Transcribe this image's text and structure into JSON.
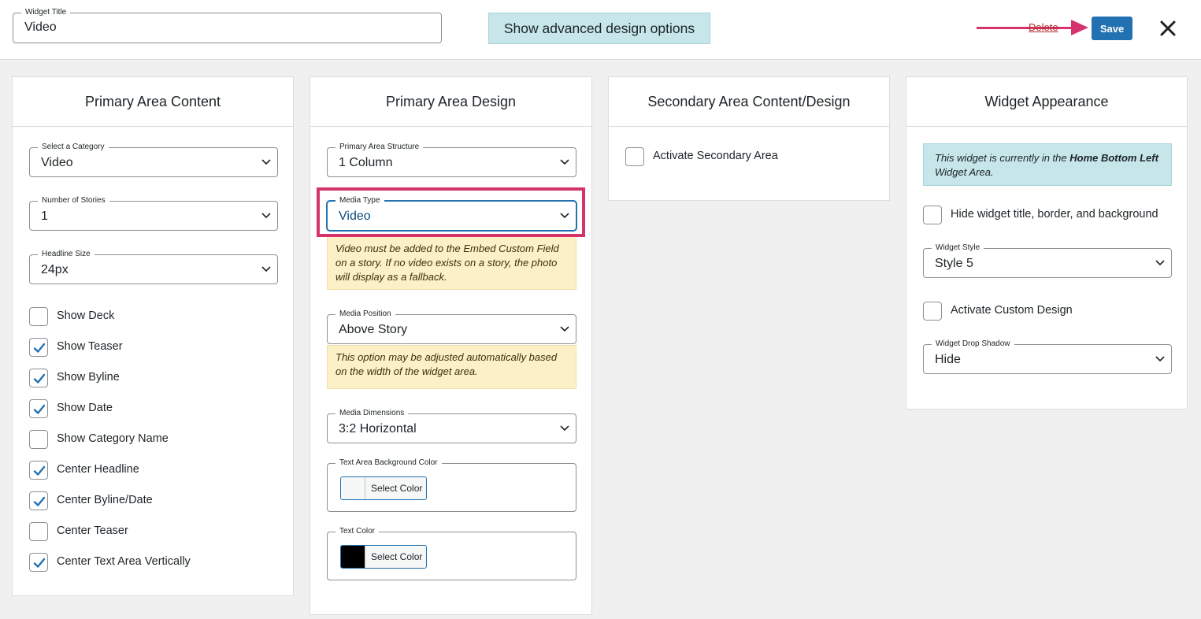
{
  "header": {
    "title_legend": "Widget Title",
    "title_value": "Video",
    "advanced_label": "Show advanced design options",
    "delete_label": "Delete",
    "save_label": "Save",
    "close_icon": "close-icon"
  },
  "colors": {
    "save": "#2271b1",
    "highlight": "#d6336c",
    "info_bg": "#c6e6ea",
    "notice_bg": "#fcf0c7",
    "check": "#2271b1"
  },
  "panels": {
    "primary_content": {
      "title": "Primary Area Content",
      "category": {
        "legend": "Select a Category",
        "value": "Video"
      },
      "stories": {
        "legend": "Number of Stories",
        "value": "1"
      },
      "headline": {
        "legend": "Headline Size",
        "value": "24px"
      },
      "checks": [
        {
          "label": "Show Deck",
          "checked": false
        },
        {
          "label": "Show Teaser",
          "checked": true
        },
        {
          "label": "Show Byline",
          "checked": true
        },
        {
          "label": "Show Date",
          "checked": true
        },
        {
          "label": "Show Category Name",
          "checked": false
        },
        {
          "label": "Center Headline",
          "checked": true
        },
        {
          "label": "Center Byline/Date",
          "checked": true
        },
        {
          "label": "Center Teaser",
          "checked": false
        },
        {
          "label": "Center Text Area Vertically",
          "checked": true
        }
      ]
    },
    "primary_design": {
      "title": "Primary Area Design",
      "structure": {
        "legend": "Primary Area Structure",
        "value": "1 Column"
      },
      "media_type": {
        "legend": "Media Type",
        "value": "Video"
      },
      "media_type_notice": "Video must be added to the Embed Custom Field on a story. If no video exists on a story, the photo will display as a fallback.",
      "media_position": {
        "legend": "Media Position",
        "value": "Above Story"
      },
      "media_position_notice": "This option may be adjusted automatically based on the width of the widget area.",
      "media_dimensions": {
        "legend": "Media Dimensions",
        "value": "3:2 Horizontal"
      },
      "bg_color": {
        "legend": "Text Area Background Color",
        "button": "Select Color",
        "swatch": "#f6f7f7"
      },
      "text_color": {
        "legend": "Text Color",
        "button": "Select Color",
        "swatch": "#000000"
      }
    },
    "secondary": {
      "title": "Secondary Area Content/Design",
      "activate_label": "Activate Secondary Area",
      "activate_checked": false
    },
    "appearance": {
      "title": "Widget Appearance",
      "info_prefix": "This widget is currently in the ",
      "info_area": "Home Bottom Left",
      "info_suffix": " Widget Area.",
      "hide_label": "Hide widget title, border, and background",
      "hide_checked": false,
      "style": {
        "legend": "Widget Style",
        "value": "Style 5"
      },
      "custom_label": "Activate Custom Design",
      "custom_checked": false,
      "shadow": {
        "legend": "Widget Drop Shadow",
        "value": "Hide"
      }
    }
  }
}
